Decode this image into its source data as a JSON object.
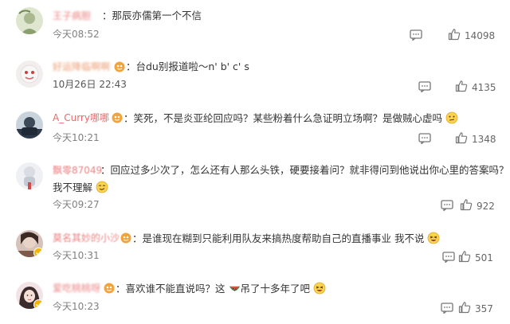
{
  "colors": {
    "username_red": "#e86b6b",
    "username_orange": "#e98b5a",
    "text": "#333333",
    "meta": "#808080",
    "vip_badge": "#f3a33a",
    "verified_badge": "#f5b400"
  },
  "comments": [
    {
      "username": "王子病胆",
      "text": "：那辰亦儒第一个不信",
      "time": "今天08:52",
      "likes": "14098"
    },
    {
      "username": "好运降临啊啊",
      "text": "：台du别报道啦～n' b' c' s",
      "time": "10月26日 22:43",
      "likes": "4135"
    },
    {
      "username": "A_Curry哪哪",
      "text": "：笑死，不是炎亚纶回应吗？某些粉着什么急证明立场啊？是做贼心虚吗",
      "time": "今天10:21",
      "likes": "1348"
    },
    {
      "username": "飘零87049",
      "text": "：回应过多少次了，怎么还有人那么头铁，硬要接着问？就非得问到他说出你心里的答案吗？",
      "text_line2": "我不理解",
      "time": "今天09:27",
      "likes": "922"
    },
    {
      "username": "莫名其妙的小沙",
      "text": "：是谁现在糊到只能利用队友来搞热度帮助自己的直播事业 我不说",
      "time": "今天10:31",
      "likes": "501"
    },
    {
      "username": "爱吃桃桃呀",
      "text": "：喜欢谁不能直说吗？这",
      "text_after_emoji": "吊了十多年了吧",
      "time": "今天10:23",
      "likes": "357"
    }
  ]
}
